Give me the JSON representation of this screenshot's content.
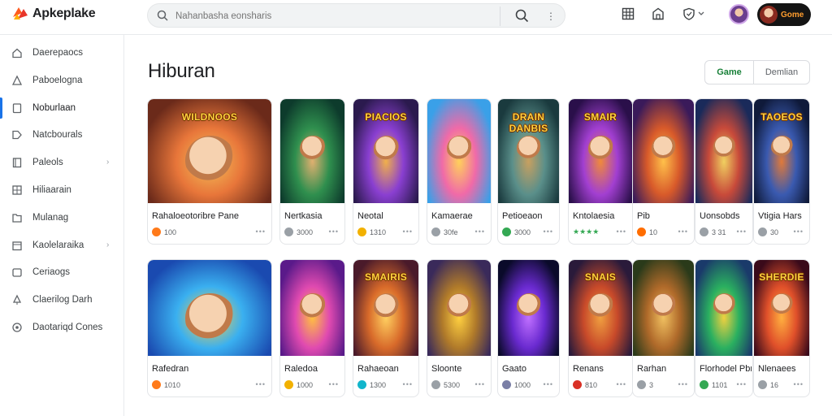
{
  "app": {
    "name": "Apkeplake"
  },
  "search": {
    "placeholder": "Nahanbasha eonsharis"
  },
  "header_pill": {
    "label": "Gome"
  },
  "sidebar": {
    "items": [
      {
        "label": "Daerepaocs",
        "icon": "home-icon",
        "chevron": false,
        "active": false
      },
      {
        "label": "Paboelogna",
        "icon": "apps-icon",
        "chevron": false,
        "active": false
      },
      {
        "label": "Noburlaan",
        "icon": "flag-icon",
        "chevron": false,
        "active": true
      },
      {
        "label": "Natcbourals",
        "icon": "tag-icon",
        "chevron": false,
        "active": false
      },
      {
        "label": "Paleols",
        "icon": "book-icon",
        "chevron": true,
        "active": false
      },
      {
        "label": "Hiliaarain",
        "icon": "grid-icon",
        "chevron": false,
        "active": false
      },
      {
        "label": "Mulanag",
        "icon": "folder-icon",
        "chevron": false,
        "active": false
      },
      {
        "label": "Kaolelaraika",
        "icon": "calendar-icon",
        "chevron": true,
        "active": false
      },
      {
        "label": "Ceriaogs",
        "icon": "box-icon",
        "chevron": false,
        "active": false
      },
      {
        "label": "Claerilog Darh",
        "icon": "pin-icon",
        "chevron": false,
        "active": false
      },
      {
        "label": "Daotariqd Cones",
        "icon": "circle-icon",
        "chevron": false,
        "active": false
      }
    ]
  },
  "main": {
    "title": "Hiburan",
    "toggle": {
      "options": [
        "Game",
        "Demlian"
      ],
      "selected": "Game"
    },
    "art_titles": {
      "r1c1": "WILDNOOS",
      "r1c3": "PIACIOS",
      "r1c5": "DRAIN DANBIS",
      "r1c6": "SMAIR",
      "r1c7": "TAOEOS",
      "r2c3": "SMAIRIS",
      "r2c6": "SNAIS",
      "r2c7": "SHERDIE"
    },
    "row1": [
      {
        "name": "Rahaloeotoribre Pane",
        "meta": "100",
        "dot": "#ff7a1a"
      },
      {
        "name": "Nertkasia",
        "meta": "3000",
        "dot": "#9aa0a6"
      },
      {
        "name": "Neotal",
        "meta": "1310",
        "dot": "#f2b100"
      },
      {
        "name": "Kamaerae",
        "meta": "30fe",
        "dot": "#9aa0a6"
      },
      {
        "name": "Petioeaon",
        "meta": "3000",
        "dot": "#34a853"
      },
      {
        "name": "Kntolaesia",
        "meta": "★★★★",
        "dot": ""
      },
      {
        "name": "Pib",
        "meta": "10",
        "dot": "#ff6d00"
      },
      {
        "name": "Uonsobds",
        "meta": "3 31",
        "dot": "#9aa0a6"
      },
      {
        "name": "Vtigia Hars",
        "meta": "30",
        "dot": "#9aa0a6"
      }
    ],
    "row2": [
      {
        "name": "Rafedran",
        "meta": "1010",
        "dot": "#ff7a1a"
      },
      {
        "name": "Raledoa",
        "meta": "1000",
        "dot": "#f2b100"
      },
      {
        "name": "Rahaeoan",
        "meta": "1300",
        "dot": "#12b5cb"
      },
      {
        "name": "Sloonte",
        "meta": "5300",
        "dot": "#9aa0a6"
      },
      {
        "name": "Gaato",
        "meta": "1000",
        "dot": "#7a7fa6"
      },
      {
        "name": "Renans",
        "meta": "810",
        "dot": "#d93025"
      },
      {
        "name": "Rarhan",
        "meta": "3",
        "dot": "#9aa0a6"
      },
      {
        "name": "Florhodel Pbnra",
        "meta": "1101",
        "dot": "#34a853"
      },
      {
        "name": "Nlenaees",
        "meta": "16",
        "dot": "#9aa0a6"
      }
    ]
  }
}
